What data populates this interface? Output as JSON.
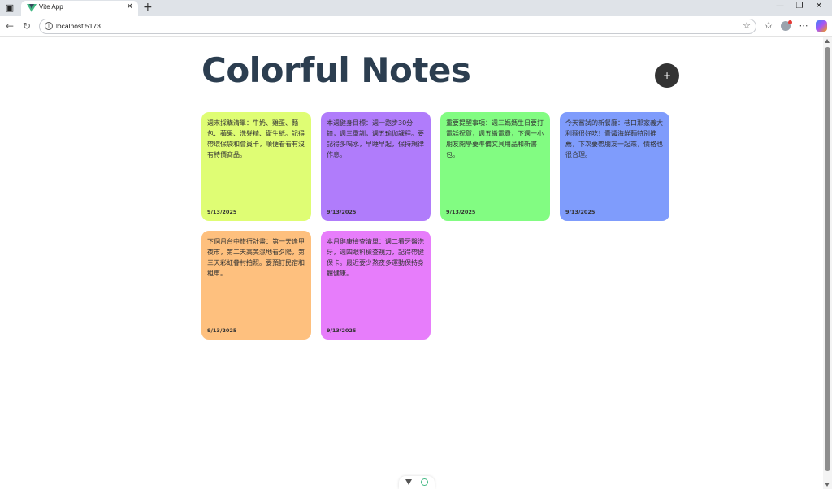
{
  "browser": {
    "tab_title": "Vite App",
    "tab_close": "✕",
    "new_tab": "+",
    "url": "localhost:5173",
    "window_controls": {
      "minimize": "—",
      "restore": "❐",
      "close": "✕"
    },
    "icons": [
      "sidebar-icon",
      "vue-favicon-icon",
      "back-icon",
      "reload-icon",
      "info-icon",
      "star-icon",
      "favorites-icon",
      "profile-icon",
      "more-icon",
      "copilot-icon"
    ]
  },
  "app": {
    "title": "Colorful Notes",
    "add_button_label": "+"
  },
  "notes": [
    {
      "text": "週末採購清單：牛奶、雞蛋、麵包、蘋果、洗髮精、衛生紙。記得帶環保袋和會員卡，順便看看有沒有特價商品。",
      "date": "9/13/2025",
      "color": "#dffd74"
    },
    {
      "text": "本週健身目標：週一跑步30分鐘，週三重訓，週五瑜伽課程。要記得多喝水，早睡早起，保持規律作息。",
      "date": "9/13/2025",
      "color": "#b07cfb"
    },
    {
      "text": "重要提醒事項：週三媽媽生日要打電話祝賀，週五繳電費，下週一小朋友開學要準備文具用品和新書包。",
      "date": "9/13/2025",
      "color": "#82fc82"
    },
    {
      "text": "今天嘗試的新餐廳：巷口那家義大利麵很好吃！青醬海鮮麵特別推薦，下次要帶朋友一起來，價格也很合理。",
      "date": "9/13/2025",
      "color": "#7f9cfc"
    },
    {
      "text": "下個月台中旅行計畫：第一天逢甲夜市，第二天高美濕地看夕陽，第三天彩虹眷村拍照。要預訂民宿和租車。",
      "date": "9/13/2025",
      "color": "#fec07e"
    },
    {
      "text": "本月健康檢查清單：週二看牙醫洗牙，週四眼科檢查視力，記得帶健保卡。最近要少熬夜多運動保持身體健康。",
      "date": "9/13/2025",
      "color": "#e77dfb"
    }
  ]
}
